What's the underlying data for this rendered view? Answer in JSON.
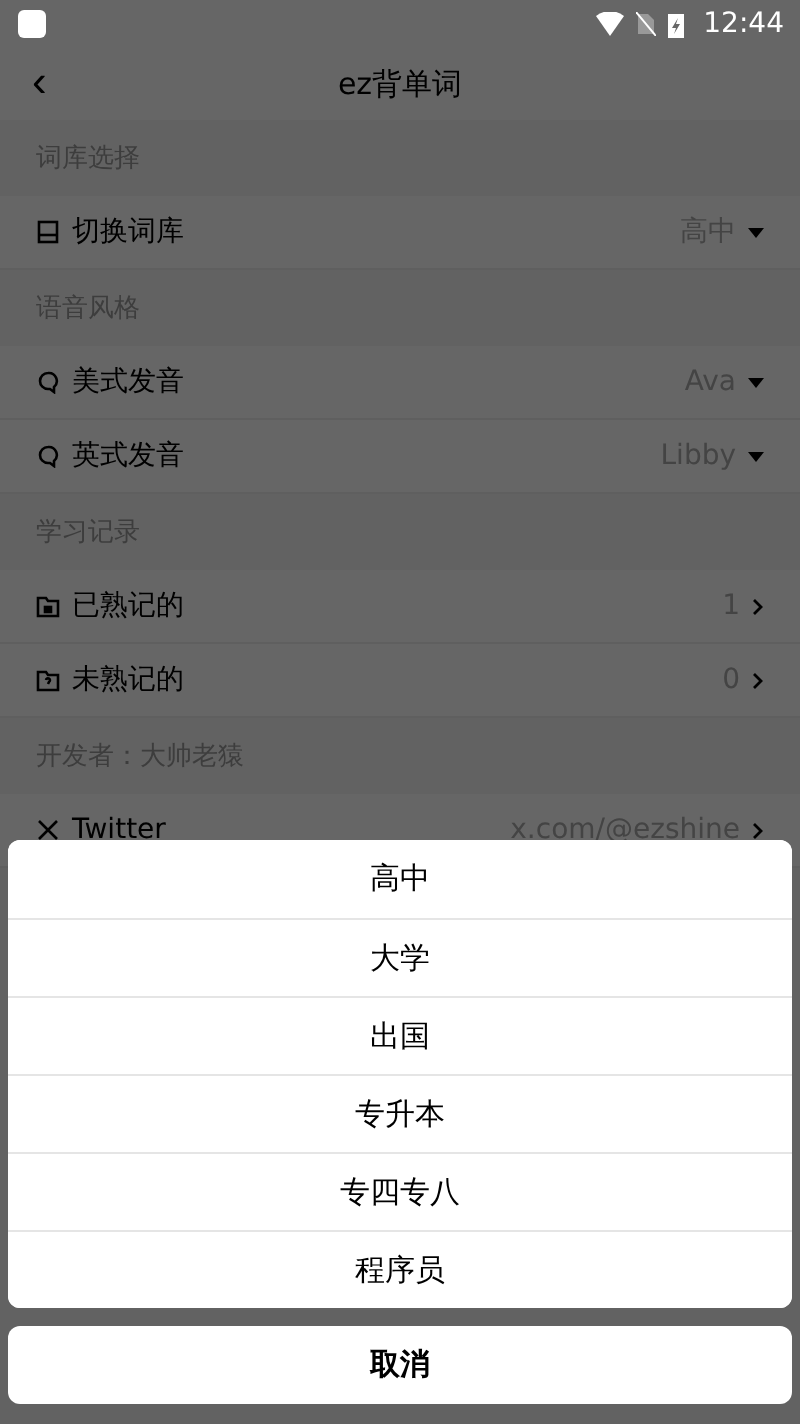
{
  "status_bar": {
    "time": "12:44"
  },
  "header": {
    "back": "‹",
    "title": "ez背单词"
  },
  "sections": [
    {
      "title": "词库选择",
      "rows": [
        {
          "kind": "dropdown",
          "label": "切换词库",
          "value": "高中"
        }
      ]
    },
    {
      "title": "语音风格",
      "rows": [
        {
          "kind": "dropdown",
          "label": "美式发音",
          "value": "Ava"
        },
        {
          "kind": "dropdown",
          "label": "英式发音",
          "value": "Libby"
        }
      ]
    },
    {
      "title": "学习记录",
      "rows": [
        {
          "kind": "link",
          "label": "已熟记的",
          "value": "1"
        },
        {
          "kind": "link",
          "label": "未熟记的",
          "value": "0"
        }
      ]
    },
    {
      "title": "开发者：大帅老猿",
      "rows": [
        {
          "kind": "link",
          "label": "Twitter",
          "value": "x.com/@ezshine"
        }
      ]
    }
  ],
  "action_sheet": {
    "options": [
      {
        "label": "高中"
      },
      {
        "label": "大学"
      },
      {
        "label": "出国"
      },
      {
        "label": "专升本"
      },
      {
        "label": "专四专八"
      },
      {
        "label": "程序员"
      }
    ],
    "cancel": "取消"
  }
}
